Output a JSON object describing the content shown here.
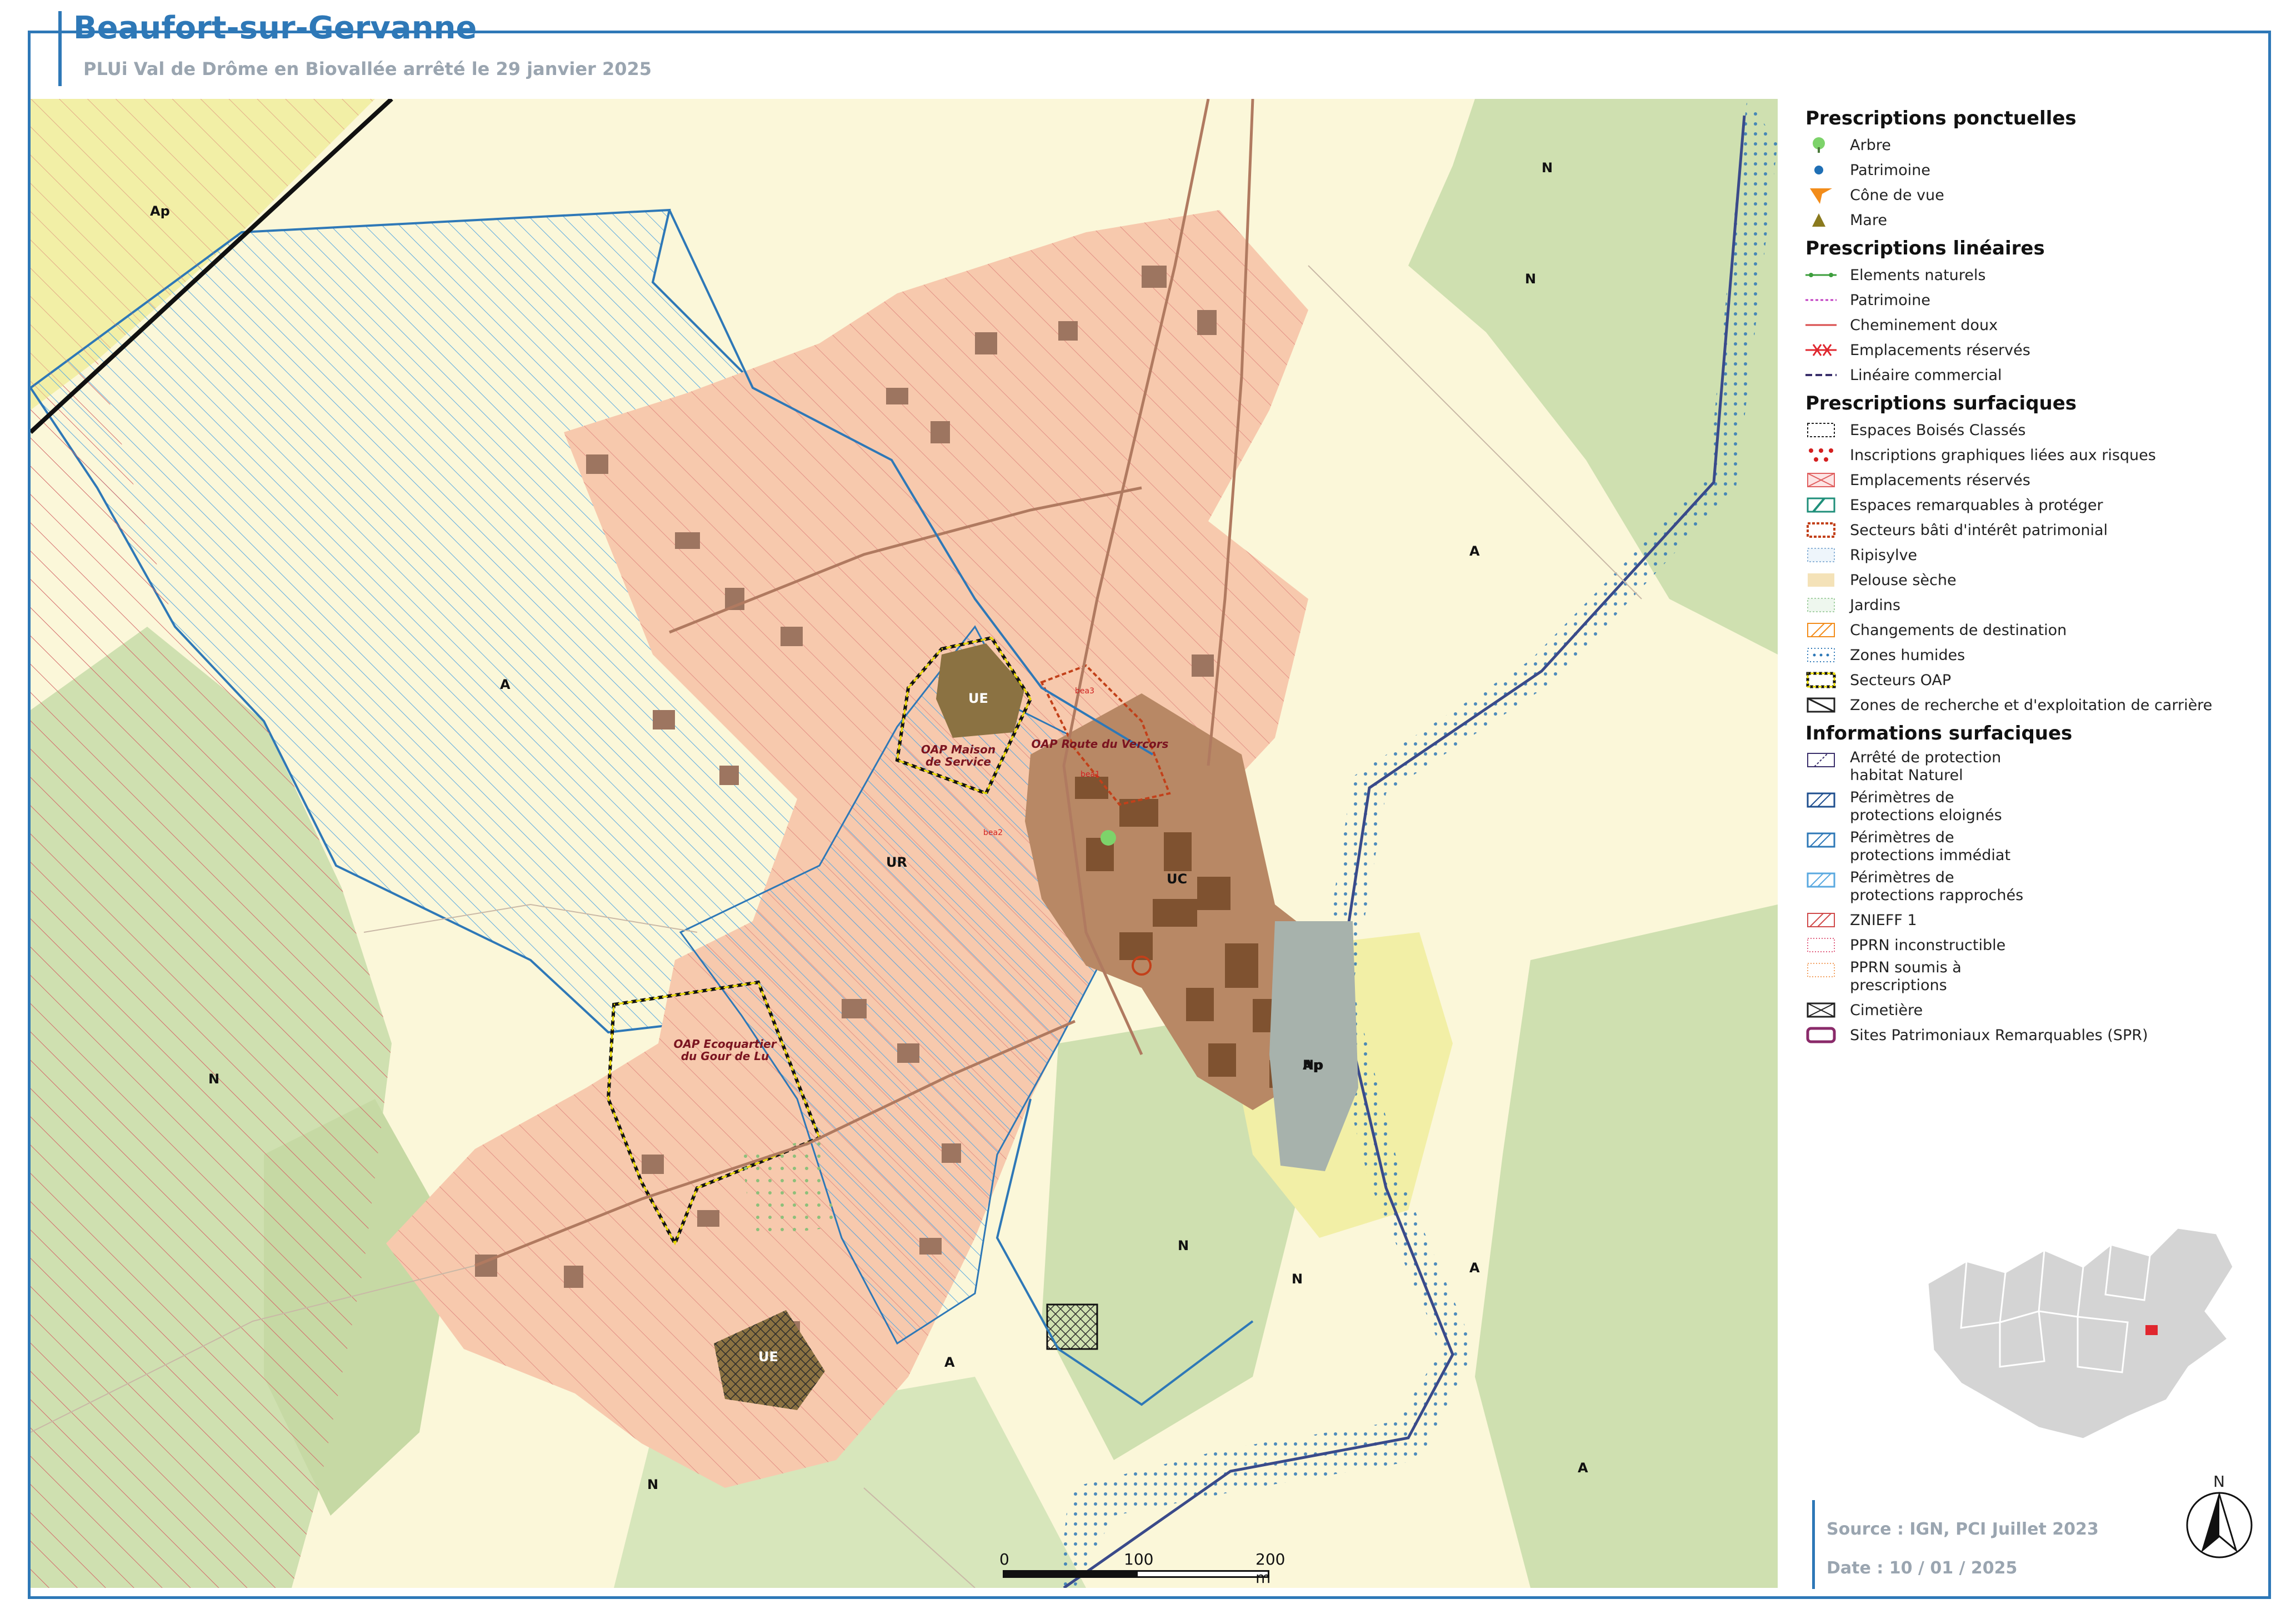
{
  "header": {
    "title": "Beaufort-sur-Gervanne",
    "subtitle": "PLUi Val de Drôme en Biovallée arrêté le 29 janvier 2025"
  },
  "map": {
    "zones": [
      {
        "label": "Ap",
        "color": "#f2efa6"
      },
      {
        "label": "A",
        "color": "#fbf7d9"
      },
      {
        "label": "N",
        "color": "#cfe0b0"
      },
      {
        "label": "UR",
        "color": "#f7c9ad"
      },
      {
        "label": "UC",
        "color": "#b88865"
      },
      {
        "label": "UE",
        "color": "#8b7242"
      },
      {
        "label": "Np",
        "color": "#a7b2ac"
      }
    ],
    "zone_labels": [
      {
        "text": "Ap",
        "zone": "Ap"
      },
      {
        "text": "Ap",
        "zone": "Ap"
      },
      {
        "text": "A",
        "zone": "A"
      },
      {
        "text": "A",
        "zone": "A"
      },
      {
        "text": "A",
        "zone": "A"
      },
      {
        "text": "A",
        "zone": "A"
      },
      {
        "text": "A",
        "zone": "A"
      },
      {
        "text": "N",
        "zone": "N"
      },
      {
        "text": "N",
        "zone": "N"
      },
      {
        "text": "N",
        "zone": "N"
      },
      {
        "text": "N",
        "zone": "N"
      },
      {
        "text": "N",
        "zone": "N"
      },
      {
        "text": "N",
        "zone": "N"
      },
      {
        "text": "UR",
        "zone": "UR"
      },
      {
        "text": "UC",
        "zone": "UC"
      },
      {
        "text": "UE",
        "zone": "UE"
      },
      {
        "text": "UE",
        "zone": "UE"
      },
      {
        "text": "Np",
        "zone": "Np"
      }
    ],
    "oap_labels": [
      "OAP Maison de Service",
      "OAP Route du Vercors",
      "OAP Ecoquartier du Gour de Lu"
    ],
    "reserved_labels": [
      "bea3",
      "bea1",
      "bea2"
    ]
  },
  "legend": {
    "sections": [
      {
        "title": "Prescriptions ponctuelles",
        "items": [
          {
            "label": "Arbre",
            "icon": "tree-icon",
            "color": "#7dd36a"
          },
          {
            "label": "Patrimoine",
            "icon": "heritage-dot-icon",
            "color": "#1f6fb5"
          },
          {
            "label": "Cône de vue",
            "icon": "view-cone-icon",
            "color": "#f28c1a"
          },
          {
            "label": "Mare",
            "icon": "pond-triangle-icon",
            "color": "#8a7a1e"
          }
        ]
      },
      {
        "title": "Prescriptions linéaires",
        "items": [
          {
            "label": "Elements naturels",
            "icon": "natural-line-icon",
            "color": "#3d9e3d"
          },
          {
            "label": "Patrimoine",
            "icon": "heritage-line-icon",
            "color": "#c23fc2"
          },
          {
            "label": "Cheminement doux",
            "icon": "soft-path-line-icon",
            "color": "#d84a4a"
          },
          {
            "label": "Emplacements réservés",
            "icon": "reserved-line-icon",
            "color": "#e0262e"
          },
          {
            "label": "Linéaire commercial",
            "icon": "commercial-line-icon",
            "color": "#3a2f6b"
          }
        ]
      },
      {
        "title": "Prescriptions surfaciques",
        "items": [
          {
            "label": "Espaces Boisés Classés",
            "icon": "classified-woods-icon",
            "color": "#2e7d4a"
          },
          {
            "label": "Inscriptions graphiques liées aux risques",
            "icon": "risk-dots-icon",
            "color": "#d42020"
          },
          {
            "label": "Emplacements réservés",
            "icon": "reserved-area-icon",
            "color": "#e06060"
          },
          {
            "label": "Espaces remarquables à protéger",
            "icon": "remarkable-space-icon",
            "color": "#1f8f7a"
          },
          {
            "label": "Secteurs bâti d'intérêt patrimonial",
            "icon": "heritage-sector-icon",
            "color": "#c2401a"
          },
          {
            "label": "Ripisylve",
            "icon": "riparian-icon",
            "color": "#8fb5d9"
          },
          {
            "label": "Pelouse sèche",
            "icon": "dry-grassland-icon",
            "color": "#e8c98a"
          },
          {
            "label": "Jardins",
            "icon": "gardens-icon",
            "color": "#a6d1a6"
          },
          {
            "label": "Changements de destination",
            "icon": "destination-change-icon",
            "color": "#f28c1a"
          },
          {
            "label": "Zones humides",
            "icon": "wetlands-icon",
            "color": "#2e78b7"
          },
          {
            "label": "Secteurs OAP",
            "icon": "oap-sector-icon",
            "color": "#e6d800"
          },
          {
            "label": "Zones de recherche et d'exploitation de carrière",
            "icon": "quarry-icon",
            "color": "#222222"
          }
        ]
      },
      {
        "title": "Informations surfaciques",
        "items": [
          {
            "label": "Arrêté de protection habitat Naturel",
            "icon": "habitat-protection-icon",
            "color": "#3a2f6b",
            "tall": true
          },
          {
            "label": "Périmètres de protections eloignés",
            "icon": "far-perimeter-icon",
            "color": "#1f4f8f",
            "tall": true
          },
          {
            "label": "Périmètres de protections immédiat",
            "icon": "immediate-perimeter-icon",
            "color": "#2e78b7",
            "tall": true
          },
          {
            "label": "Périmètres de protections rapprochés",
            "icon": "close-perimeter-icon",
            "color": "#5aa9e0",
            "tall": true
          },
          {
            "label": "ZNIEFF 1",
            "icon": "znieff-icon",
            "color": "#d04a4a"
          },
          {
            "label": "PPRN inconstructible",
            "icon": "pprn-unbuildable-icon",
            "color": "#e06080"
          },
          {
            "label": "PPRN soumis à prescriptions",
            "icon": "pprn-prescriptions-icon",
            "color": "#f2a060",
            "tall": true
          },
          {
            "label": "Cimetière",
            "icon": "cemetery-icon",
            "color": "#222222"
          },
          {
            "label": "Sites Patrimoniaux Remarquables (SPR)",
            "icon": "spr-icon",
            "color": "#8a2a6a"
          }
        ]
      }
    ]
  },
  "scale": {
    "ticks": [
      "0",
      "100",
      "200 m"
    ]
  },
  "north": {
    "label": "N"
  },
  "footer": {
    "source": "Source : IGN, PCI Juillet 2023",
    "date": "Date : 10 / 01 / 2025"
  }
}
